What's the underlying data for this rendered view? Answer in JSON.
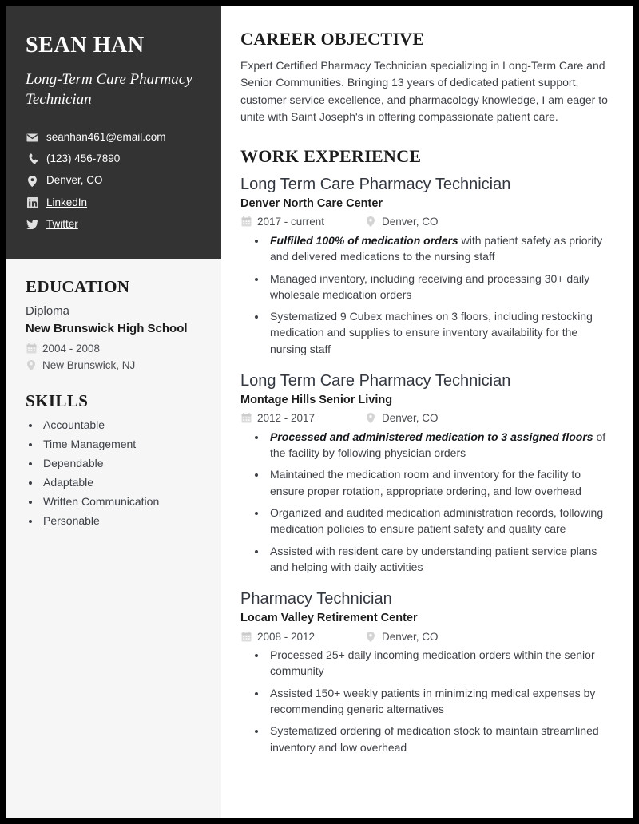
{
  "header": {
    "name": "SEAN HAN",
    "subtitle": "Long-Term Care Pharmacy Technician",
    "contacts": [
      {
        "icon": "envelope-icon",
        "text": "seanhan461@email.com",
        "link": false
      },
      {
        "icon": "phone-icon",
        "text": "(123) 456-7890",
        "link": false
      },
      {
        "icon": "map-pin-icon",
        "text": "Denver, CO",
        "link": false
      },
      {
        "icon": "linkedin-icon",
        "text": "LinkedIn",
        "link": true
      },
      {
        "icon": "twitter-icon",
        "text": "Twitter",
        "link": true
      }
    ]
  },
  "sidebar": {
    "education": {
      "heading": "EDUCATION",
      "degree": "Diploma",
      "school": "New Brunswick High School",
      "dates": "2004 - 2008",
      "location": "New Brunswick, NJ"
    },
    "skills": {
      "heading": "SKILLS",
      "items": [
        "Accountable",
        "Time Management",
        "Dependable",
        "Adaptable",
        "Written Communication",
        "Personable"
      ]
    }
  },
  "main": {
    "objective": {
      "heading": "CAREER OBJECTIVE",
      "text": "Expert Certified Pharmacy Technician specializing in Long-Term Care and Senior Communities. Bringing 13 years of dedicated patient support, customer service excellence, and pharmacology knowledge, I am eager to unite with Saint Joseph's in offering compassionate patient care."
    },
    "work": {
      "heading": "WORK EXPERIENCE",
      "jobs": [
        {
          "title": "Long Term Care Pharmacy Technician",
          "company": "Denver North Care Center",
          "dates": "2017 - current",
          "location": "Denver, CO",
          "bullets": [
            {
              "lead": "Fulfilled 100% of medication orders",
              "rest": " with patient safety as priority and delivered medications to the nursing staff"
            },
            {
              "lead": "",
              "rest": "Managed inventory, including receiving and processing 30+ daily wholesale medication orders"
            },
            {
              "lead": "",
              "rest": "Systematized 9 Cubex machines on 3 floors, including restocking medication and supplies to ensure inventory availability for the nursing staff"
            }
          ]
        },
        {
          "title": "Long Term Care Pharmacy Technician",
          "company": "Montage Hills Senior Living",
          "dates": "2012 - 2017",
          "location": "Denver, CO",
          "bullets": [
            {
              "lead": "Processed and administered medication to 3 assigned floors",
              "rest": " of the facility by following physician orders"
            },
            {
              "lead": "",
              "rest": "Maintained the medication room and inventory for the facility to ensure proper rotation, appropriate ordering, and low overhead"
            },
            {
              "lead": "",
              "rest": "Organized and audited medication administration records, following medication policies to ensure patient safety and quality care"
            },
            {
              "lead": "",
              "rest": "Assisted with resident care by understanding patient service plans and helping with daily activities"
            }
          ]
        },
        {
          "title": "Pharmacy Technician",
          "company": "Locam Valley Retirement Center",
          "dates": "2008 - 2012",
          "location": "Denver, CO",
          "bullets": [
            {
              "lead": "",
              "rest": "Processed 25+ daily incoming medication orders within the senior community"
            },
            {
              "lead": "",
              "rest": "Assisted 150+ weekly patients in minimizing medical expenses by recommending generic alternatives"
            },
            {
              "lead": "",
              "rest": "Systematized ordering of medication stock to maintain streamlined inventory and low overhead"
            }
          ]
        }
      ]
    }
  }
}
